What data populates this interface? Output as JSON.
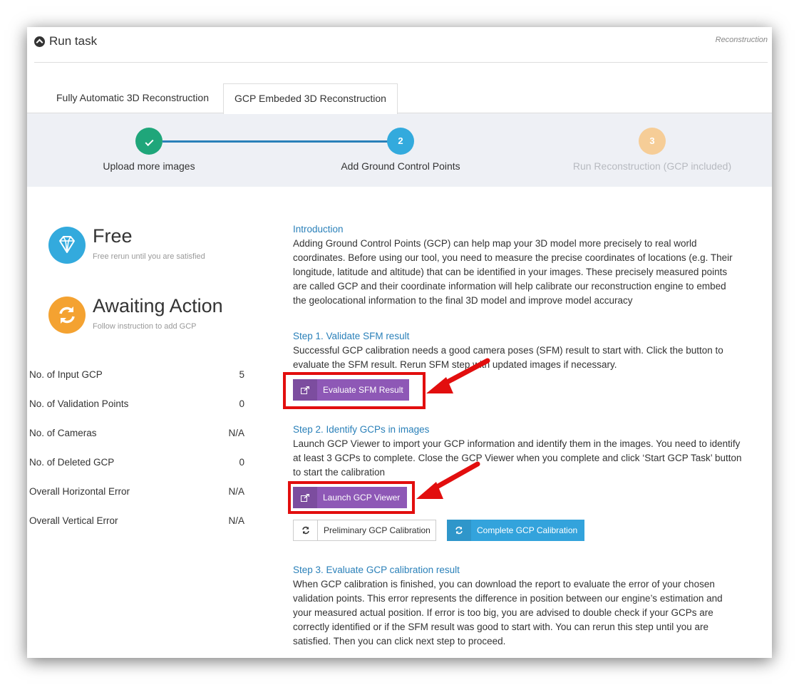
{
  "header": {
    "title": "Run task",
    "breadcrumb": "Reconstruction"
  },
  "tabs": [
    {
      "label": "Fully Automatic 3D Reconstruction"
    },
    {
      "label": "GCP Embeded 3D Reconstruction"
    }
  ],
  "steps": [
    {
      "label": "Upload more images",
      "marker": "check"
    },
    {
      "label": "Add Ground Control Points",
      "marker": "2"
    },
    {
      "label": "Run Reconstruction (GCP included)",
      "marker": "3"
    }
  ],
  "status": {
    "free": {
      "title": "Free",
      "subtitle": "Free rerun until you are satisfied",
      "icon": "diamond-icon"
    },
    "await": {
      "title": "Awaiting Action",
      "subtitle": "Follow instruction to add GCP",
      "icon": "refresh-icon"
    }
  },
  "stats": [
    {
      "label": "No. of Input GCP",
      "value": "5"
    },
    {
      "label": "No. of Validation Points",
      "value": "0"
    },
    {
      "label": "No. of Cameras",
      "value": "N/A"
    },
    {
      "label": "No. of Deleted GCP",
      "value": "0"
    },
    {
      "label": "Overall Horizontal Error",
      "value": "N/A"
    },
    {
      "label": "Overall Vertical Error",
      "value": "N/A"
    }
  ],
  "intro": {
    "title": "Introduction",
    "text": "Adding Ground Control Points (GCP) can help map your 3D model more precisely to real world coordinates. Before using our tool, you need to measure the precise coordinates of locations (e.g. Their longitude, latitude and altitude) that can be identified in your images. These precisely measured points are called GCP and their coordinate information will help calibrate our reconstruction engine to embed the geolocational information to the final 3D model and improve model accuracy"
  },
  "step1": {
    "title": "Step 1. Validate SFM result",
    "text": "Successful GCP calibration needs a good camera poses (SFM) result to start with. Click the button to evaluate the SFM result. Rerun SFM step with updated images if necessary.",
    "button": "Evaluate SFM Result"
  },
  "step2": {
    "title": "Step 2. Identify GCPs in images",
    "text": "Launch GCP Viewer to import your GCP information and identify them in the images. You need to identify at least 3 GCPs to complete. Close the GCP Viewer when you complete and click ‘Start GCP Task’ button to start the calibration",
    "button": "Launch GCP Viewer",
    "prelim_button": "Preliminary GCP Calibration",
    "complete_button": "Complete GCP Calibration"
  },
  "step3": {
    "title": "Step 3. Evaluate GCP calibration result",
    "text": "When GCP calibration is finished, you can download the report to evaluate the error of your chosen validation points. This error represents the difference in position between our engine’s estimation and your measured actual position. If error is too big, you are advised to double check if your GCPs are correctly identified or if the SFM result was good to start with. You can rerun this step until you are satisfied. Then you can click next step to proceed."
  },
  "colors": {
    "accent": "#2a80b9",
    "purple": "#8e58b6",
    "blue": "#33a3dc",
    "highlight": "#e20e0e"
  }
}
